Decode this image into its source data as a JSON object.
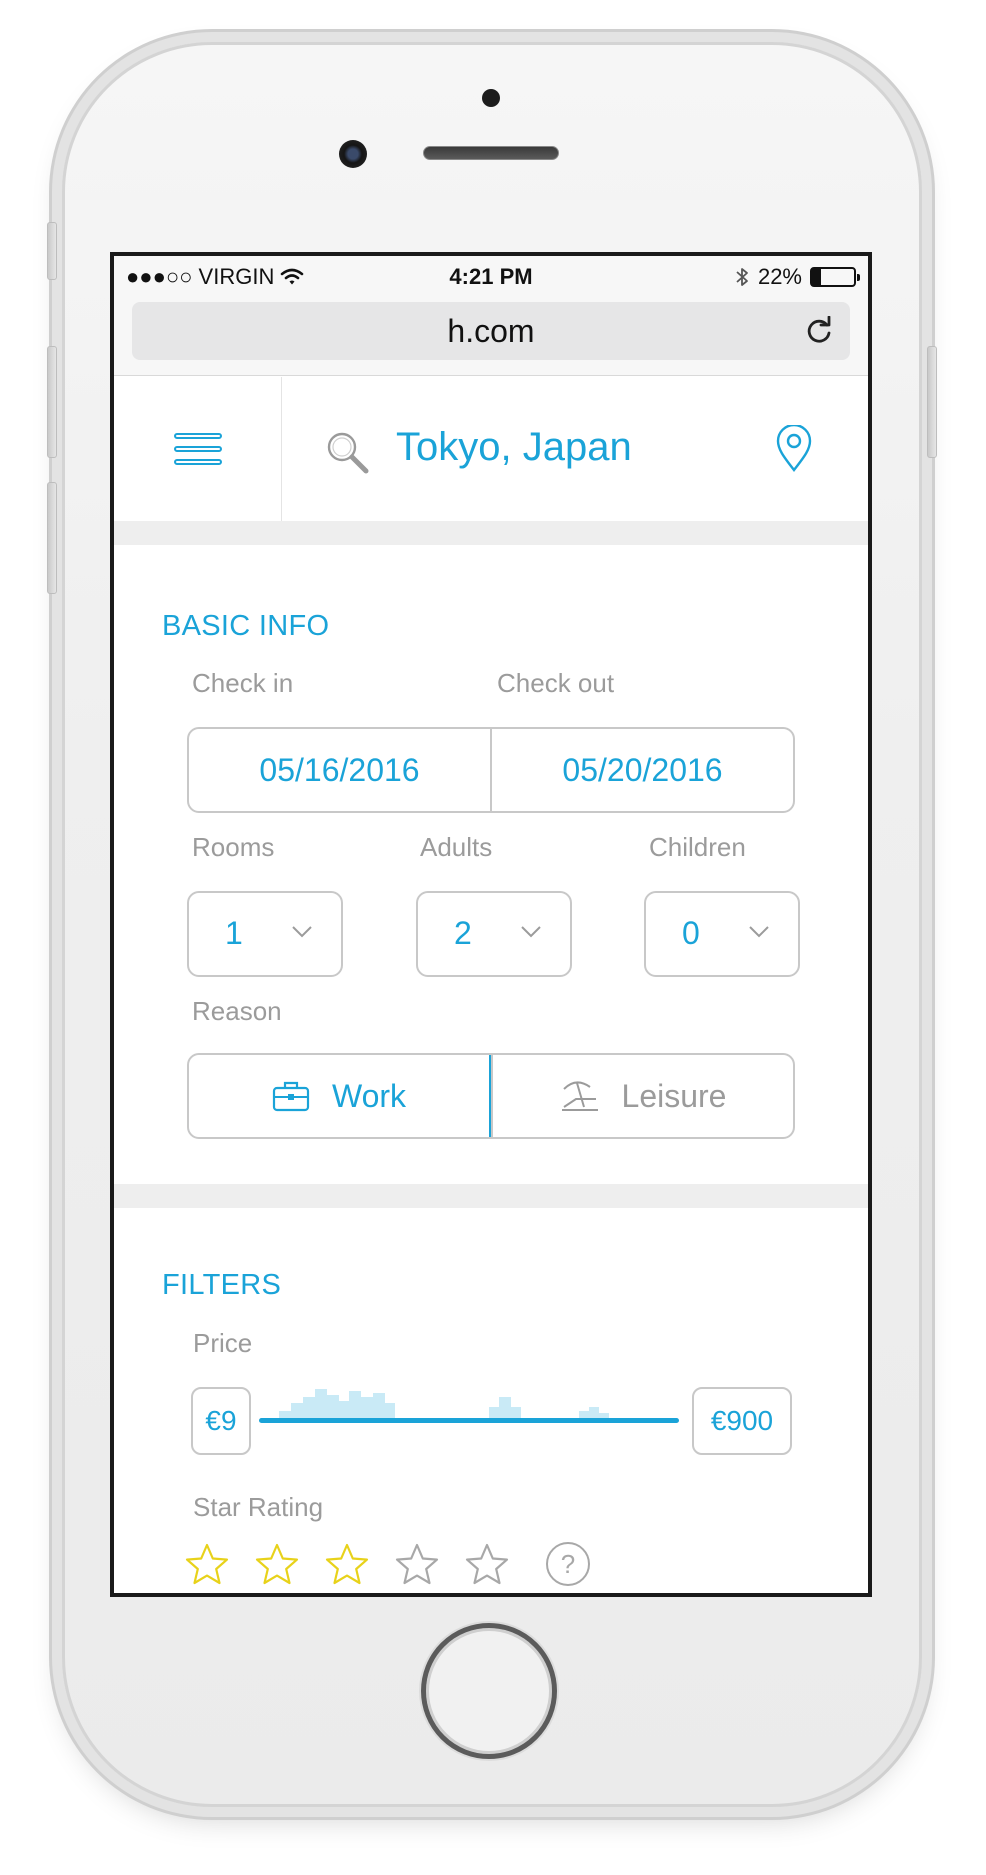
{
  "status_bar": {
    "carrier": "●●●○○ VIRGIN",
    "time": "4:21 PM",
    "battery": "22%",
    "battery_level": 0.22
  },
  "browser": {
    "url": "h.com"
  },
  "header": {
    "location": "Tokyo, Japan"
  },
  "basic_info": {
    "title": "BASIC INFO",
    "check_in_label": "Check in",
    "check_out_label": "Check out",
    "check_in_value": "05/16/2016",
    "check_out_value": "05/20/2016",
    "rooms_label": "Rooms",
    "adults_label": "Adults",
    "children_label": "Children",
    "rooms_value": "1",
    "adults_value": "2",
    "children_value": "0",
    "reason_label": "Reason",
    "reason_work": "Work",
    "reason_leisure": "Leisure",
    "reason_selected": "Work"
  },
  "filters": {
    "title": "FILTERS",
    "price_label": "Price",
    "price_min": "€9",
    "price_max": "€900",
    "star_rating_label": "Star Rating",
    "star_rating_selected": 3,
    "star_rating_max": 5,
    "help_symbol": "?"
  },
  "colors": {
    "accent": "#1aa3d8",
    "star_selected": "#e8d21a",
    "muted_text": "#9b9b9b",
    "border": "#c8c8c8"
  },
  "icons": [
    "wifi-icon",
    "bluetooth-icon",
    "battery-icon",
    "reload-icon",
    "hamburger-menu-icon",
    "search-icon",
    "location-pin-icon",
    "chevron-down-icon",
    "briefcase-icon",
    "beach-chair-icon",
    "star-icon",
    "help-icon"
  ]
}
